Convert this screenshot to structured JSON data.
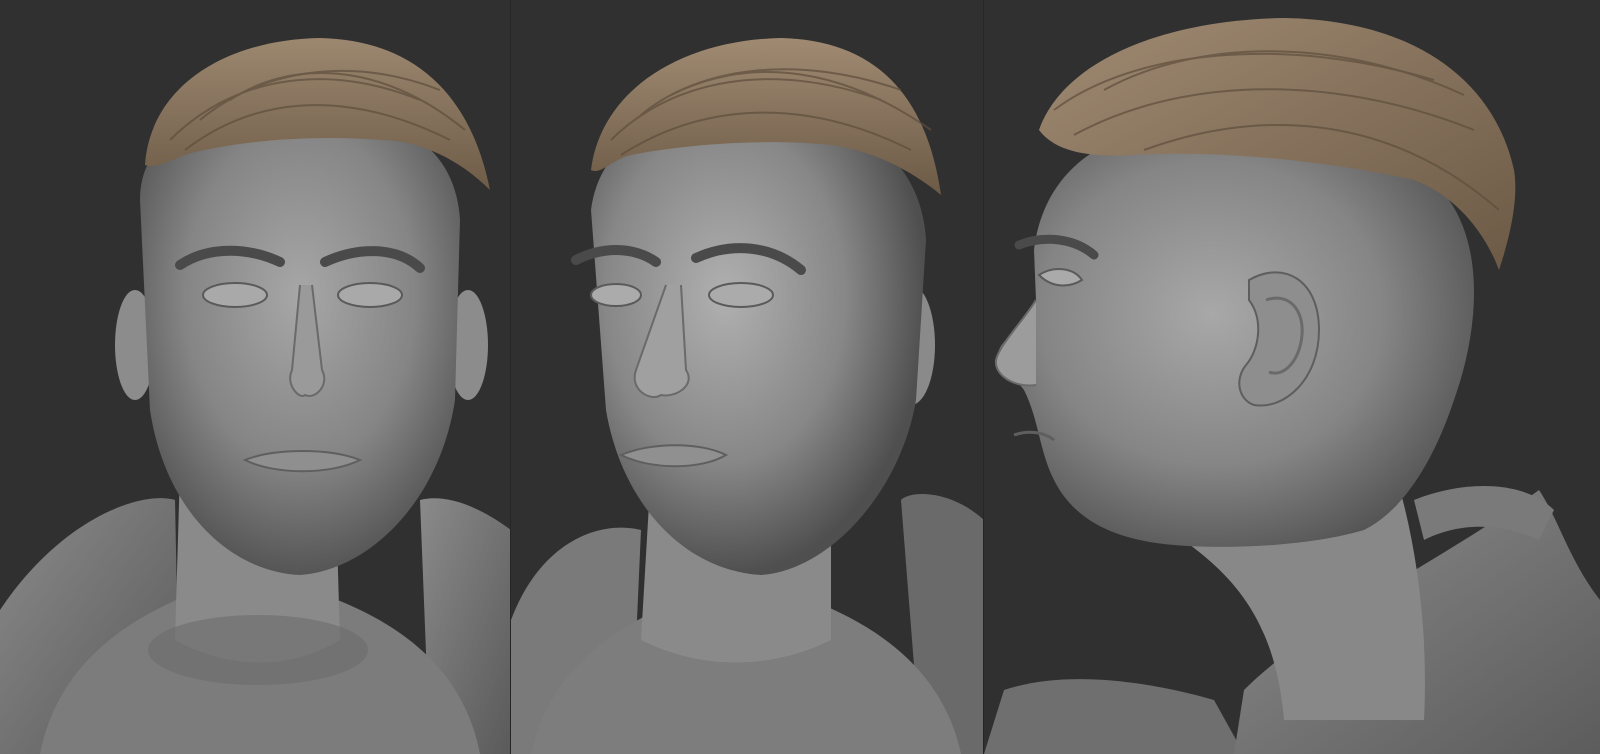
{
  "image": {
    "kind": "sculpt-render-turnaround",
    "background_color": "#303030",
    "skin_color": "#8a8a8a",
    "hair_color": "#8b7660",
    "views": [
      {
        "id": "front",
        "icon": "head-front-view"
      },
      {
        "id": "three-quarter",
        "icon": "head-three-quarter-view"
      },
      {
        "id": "profile",
        "icon": "head-profile-view"
      }
    ]
  }
}
